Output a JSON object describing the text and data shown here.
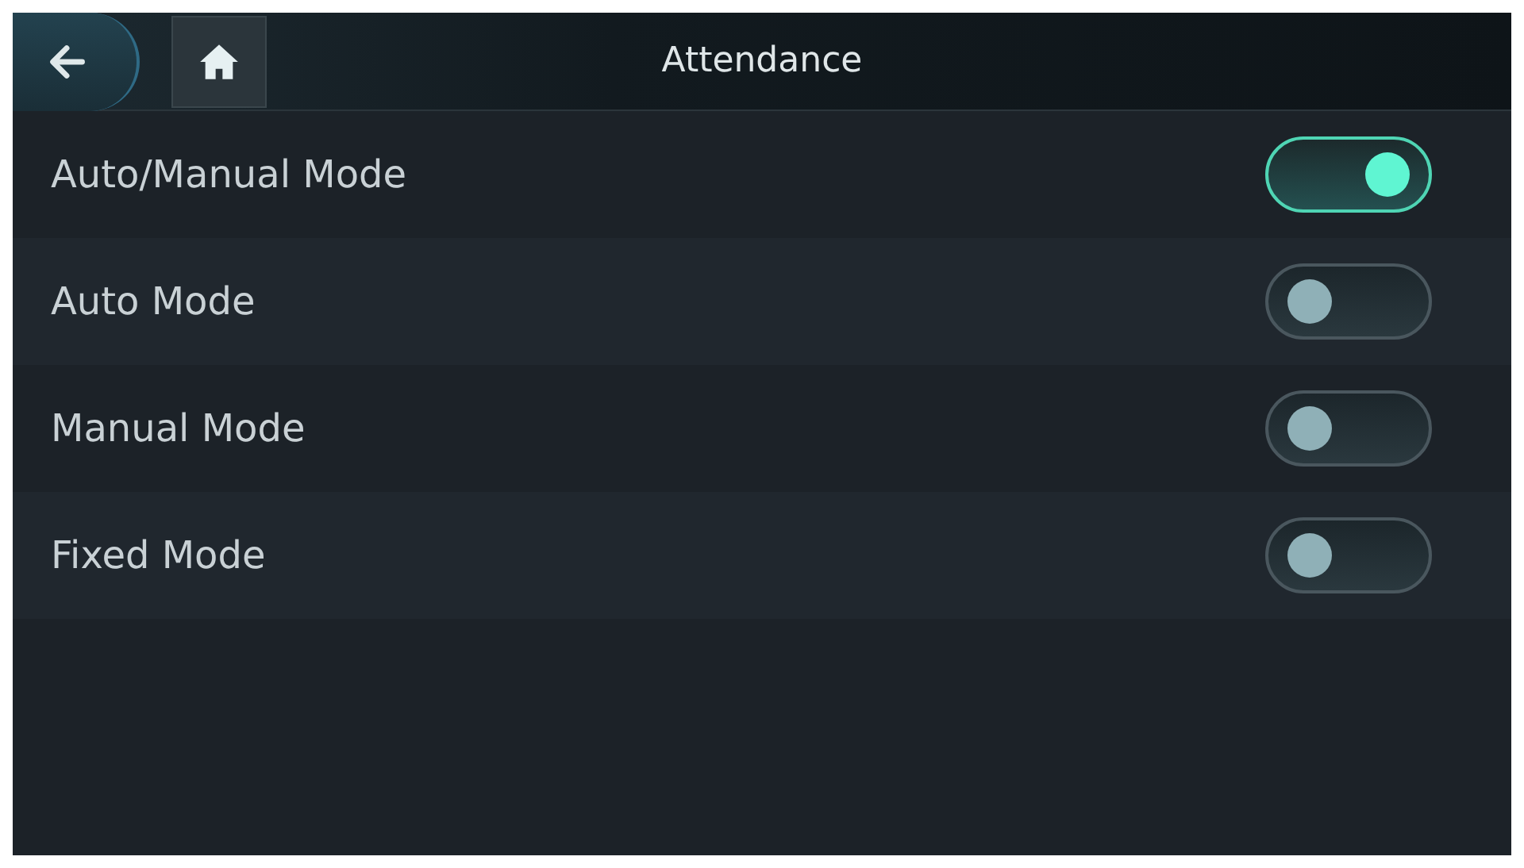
{
  "header": {
    "title": "Attendance"
  },
  "settings": [
    {
      "label": "Auto/Manual Mode",
      "on": true
    },
    {
      "label": "Auto Mode",
      "on": false
    },
    {
      "label": "Manual Mode",
      "on": false
    },
    {
      "label": "Fixed Mode",
      "on": false
    }
  ]
}
